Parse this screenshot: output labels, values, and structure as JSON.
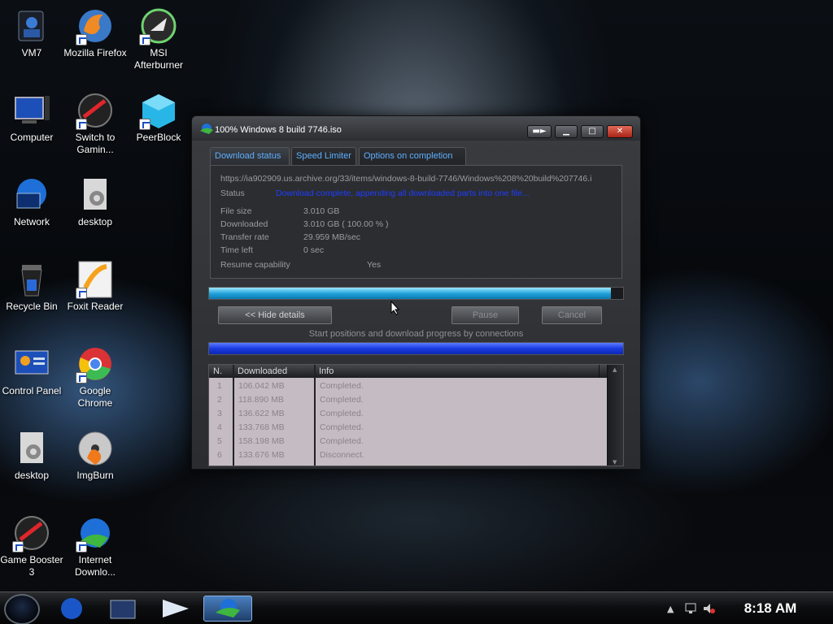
{
  "desktop": {
    "icons": [
      {
        "label": "VM7",
        "icon": "vm-folder-icon"
      },
      {
        "label": "Mozilla Firefox",
        "icon": "firefox-icon"
      },
      {
        "label": "MSI Afterburner",
        "icon": "msi-afterburner-icon"
      },
      {
        "label": "Computer",
        "icon": "computer-icon"
      },
      {
        "label": "Switch to Gamin...",
        "icon": "game-booster-icon"
      },
      {
        "label": "PeerBlock",
        "icon": "peerblock-icon"
      },
      {
        "label": "Network",
        "icon": "network-icon"
      },
      {
        "label": "desktop",
        "icon": "config-file-icon"
      },
      {
        "label": "Recycle Bin",
        "icon": "recycle-bin-icon"
      },
      {
        "label": "Foxit Reader",
        "icon": "foxit-reader-icon"
      },
      {
        "label": "Control Panel",
        "icon": "control-panel-icon"
      },
      {
        "label": "Google Chrome",
        "icon": "chrome-icon"
      },
      {
        "label": "desktop",
        "icon": "config-file-icon"
      },
      {
        "label": "ImgBurn",
        "icon": "imgburn-icon"
      },
      {
        "label": "Game Booster 3",
        "icon": "game-booster-icon"
      },
      {
        "label": "Internet Downlo...",
        "icon": "idm-icon"
      }
    ]
  },
  "window": {
    "title": "100% Windows 8 build 7746.iso",
    "tabs": [
      "Download status",
      "Speed Limiter",
      "Options on completion"
    ],
    "url": "https://ia902909.us.archive.org/33/items/windows-8-build-7746/Windows%208%20build%207746.i",
    "status_label": "Status",
    "status_value": "Download complete, appending all downloaded parts into one file...",
    "file_size_label": "File size",
    "file_size_value": "3.010  GB",
    "downloaded_label": "Downloaded",
    "downloaded_value": "3.010  GB  ( 100.00 % )",
    "transfer_rate_label": "Transfer rate",
    "transfer_rate_value": "29.959  MB/sec",
    "time_left_label": "Time left",
    "time_left_value": "0 sec",
    "resume_label": "Resume capability",
    "resume_value": "Yes",
    "progress_fraction": 1.0,
    "hide_details_label": "<< Hide details",
    "pause_label": "Pause",
    "cancel_label": "Cancel",
    "connections_label": "Start positions and download progress by connections",
    "table": {
      "headers": [
        "N.",
        "Downloaded",
        "Info"
      ],
      "rows": [
        [
          "1",
          "106.042  MB",
          "Completed."
        ],
        [
          "2",
          "118.890  MB",
          "Completed."
        ],
        [
          "3",
          "136.622  MB",
          "Completed."
        ],
        [
          "4",
          "133.768  MB",
          "Completed."
        ],
        [
          "5",
          "158.198  MB",
          "Completed."
        ],
        [
          "6",
          "133.676  MB",
          "Disconnect."
        ]
      ]
    }
  },
  "taskbar": {
    "clock": "8:18 AM"
  }
}
